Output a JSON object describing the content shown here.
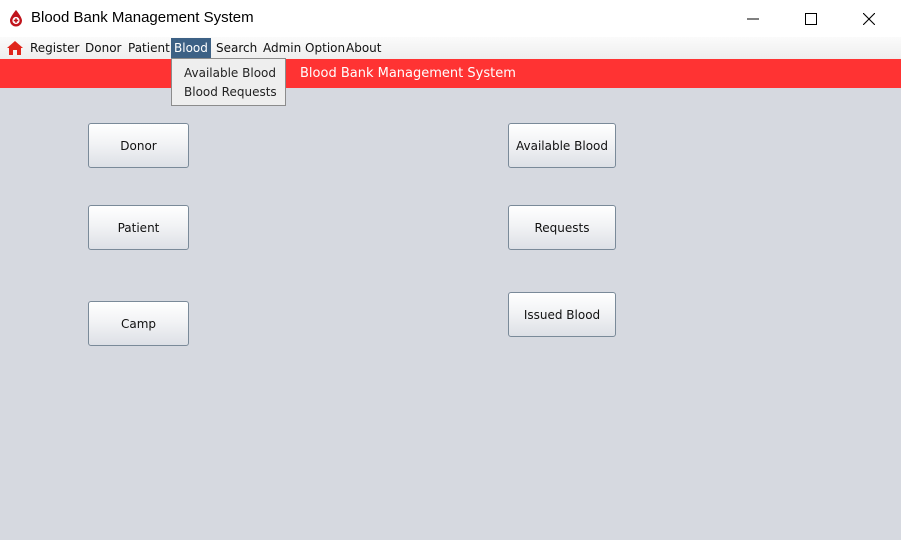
{
  "window": {
    "title": "Blood Bank Management System",
    "controls": {
      "minimize": "minimize-icon",
      "maximize": "maximize-icon",
      "close": "close-icon"
    }
  },
  "menubar": {
    "home_icon": "home-icon",
    "items": [
      {
        "label": "Register"
      },
      {
        "label": "Donor"
      },
      {
        "label": "Patient"
      },
      {
        "label": "Blood",
        "active": true
      },
      {
        "label": "Search"
      },
      {
        "label": "Admin Option"
      },
      {
        "label": "About"
      }
    ]
  },
  "blood_menu": {
    "items": [
      {
        "label": "Available Blood"
      },
      {
        "label": "Blood Requests"
      }
    ]
  },
  "banner": {
    "title": "Blood Bank Management System"
  },
  "buttons": {
    "donor": "Donor",
    "patient": "Patient",
    "camp": "Camp",
    "available_blood": "Available Blood",
    "requests": "Requests",
    "issued_blood": "Issued Blood"
  },
  "colors": {
    "banner": "#ff3333",
    "menu_active": "#3d6185",
    "background": "#d6d9e0"
  }
}
